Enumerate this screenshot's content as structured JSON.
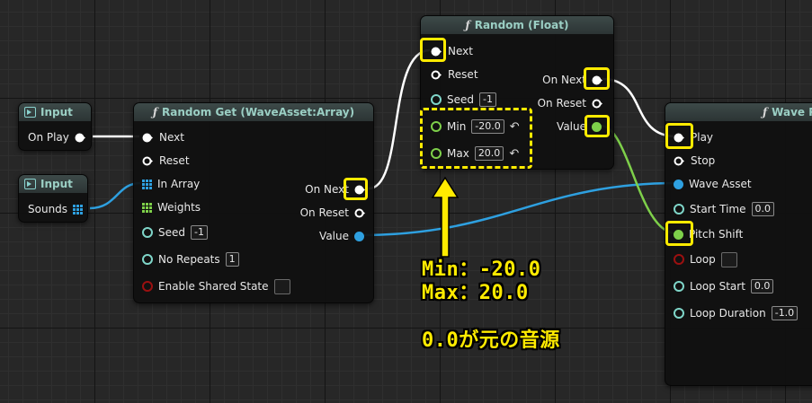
{
  "input_play": {
    "title": "Input",
    "pin": "On Play"
  },
  "input_sounds": {
    "title": "Input",
    "pin": "Sounds"
  },
  "random_get": {
    "title": "Random Get (WaveAsset:Array)",
    "inputs": {
      "next": "Next",
      "reset": "Reset",
      "in_array": "In Array",
      "weights": "Weights",
      "seed": "Seed",
      "seed_value": "-1",
      "no_repeats": "No Repeats",
      "no_repeats_value": "1",
      "enable_shared_state": "Enable Shared State"
    },
    "outputs": {
      "on_next": "On Next",
      "on_reset": "On Reset",
      "value": "Value"
    }
  },
  "random_float": {
    "title": "Random (Float)",
    "inputs": {
      "next": "Next",
      "reset": "Reset",
      "seed": "Seed",
      "seed_value": "-1",
      "min": "Min",
      "min_value": "-20.0",
      "max": "Max",
      "max_value": "20.0"
    },
    "outputs": {
      "on_next": "On Next",
      "on_reset": "On Reset",
      "value": "Value"
    }
  },
  "wave_player": {
    "title": "Wave Pl",
    "inputs": {
      "play": "Play",
      "stop": "Stop",
      "wave_asset": "Wave Asset",
      "start_time": "Start Time",
      "start_time_value": "0.0",
      "pitch_shift": "Pitch Shift",
      "loop": "Loop",
      "loop_start": "Loop Start",
      "loop_start_value": "0.0",
      "loop_duration": "Loop Duration",
      "loop_duration_value": "-1.0"
    }
  },
  "annotation": {
    "line1": "Min：-20.0",
    "line2": "Max：20.0",
    "line3": "0.0が元の音源"
  },
  "colors": {
    "exec": "#ffffff",
    "float": "#7ed04a",
    "wave_asset": "#2ea0e0",
    "trigger": "#7fd6c9",
    "bool": "#9b1010",
    "highlight": "#ffeb00"
  },
  "icons": {
    "function": "function-icon",
    "input": "input-icon",
    "reset": "reset-arrow-icon"
  }
}
